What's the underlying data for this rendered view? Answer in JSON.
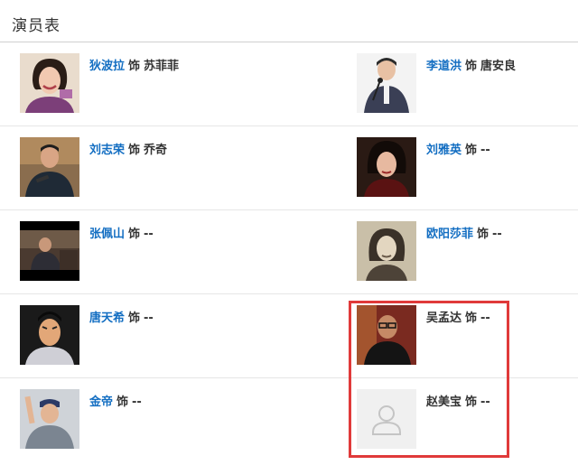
{
  "header": {
    "title": "演员表"
  },
  "cast": [
    {
      "actor": "狄波拉",
      "as": "饰",
      "role": "苏菲菲",
      "linked": true,
      "photo": "actress-smiling-photo"
    },
    {
      "actor": "李道洪",
      "as": "饰",
      "role": "唐安良",
      "linked": true,
      "photo": "man-with-microphone-photo"
    },
    {
      "actor": "刘志荣",
      "as": "饰",
      "role": "乔奇",
      "linked": true,
      "photo": "man-speaking-photo"
    },
    {
      "actor": "刘雅英",
      "as": "饰",
      "role": "--",
      "linked": true,
      "photo": "actress-in-costume-photo"
    },
    {
      "actor": "张佩山",
      "as": "饰",
      "role": "--",
      "linked": true,
      "photo": "film-still-photo"
    },
    {
      "actor": "欧阳莎菲",
      "as": "饰",
      "role": "--",
      "linked": true,
      "photo": "vintage-portrait-photo"
    },
    {
      "actor": "唐天希",
      "as": "饰",
      "role": "--",
      "linked": true,
      "photo": "period-drama-actor-photo"
    },
    {
      "actor": "吴孟达",
      "as": "饰",
      "role": "--",
      "linked": false,
      "photo": "man-with-glasses-photo"
    },
    {
      "actor": "金帝",
      "as": "饰",
      "role": "--",
      "linked": true,
      "photo": "man-waving-photo"
    },
    {
      "actor": "赵美宝",
      "as": "饰",
      "role": "--",
      "linked": false,
      "photo": "default-avatar-icon"
    }
  ],
  "colors": {
    "link": "#136ec2",
    "highlight": "#e03a3a",
    "divider": "#e6e6e6"
  }
}
